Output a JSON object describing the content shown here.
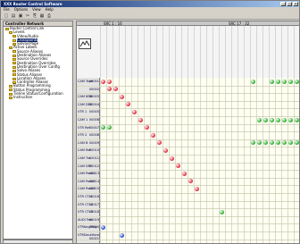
{
  "window": {
    "title": "XXX Router Control Software"
  },
  "menu": [
    "File",
    "Options",
    "View",
    "Help"
  ],
  "toolbar": {
    "icons": [
      "new-icon",
      "open-icon",
      "save-icon",
      "cut-icon",
      "copy-icon",
      "paste-icon",
      "print-icon"
    ]
  },
  "tree": {
    "title": "Controller Network",
    "items": [
      {
        "label": "Router Control Link",
        "indent": 0,
        "selected": false
      },
      {
        "label": "Levels",
        "indent": 1,
        "selected": false
      },
      {
        "label": "Video/Audio",
        "indent": 2,
        "selected": false
      },
      {
        "label": "Crosspoints",
        "indent": 2,
        "selected": true
      },
      {
        "label": "Salvos/Page",
        "indent": 2,
        "selected": false
      },
      {
        "label": "Active Labels",
        "indent": 1,
        "selected": false
      },
      {
        "label": "Source Aliases",
        "indent": 2,
        "selected": false
      },
      {
        "label": "Destination Aliases",
        "indent": 2,
        "selected": false
      },
      {
        "label": "Source Overrides",
        "indent": 2,
        "selected": false
      },
      {
        "label": "Destination Overrides",
        "indent": 2,
        "selected": false
      },
      {
        "label": "Destination Over Config",
        "indent": 2,
        "selected": false
      },
      {
        "label": "Salvo Aliases",
        "indent": 2,
        "selected": false
      },
      {
        "label": "Status Aliases",
        "indent": 2,
        "selected": false
      },
      {
        "label": "Location Aliases",
        "indent": 2,
        "selected": false
      },
      {
        "label": "Controller Aliases",
        "indent": 2,
        "selected": false
      },
      {
        "label": "Button Programming",
        "indent": 1,
        "selected": false
      },
      {
        "label": "Status Programming",
        "indent": 1,
        "selected": false
      },
      {
        "label": "Tieline Status/Configuration",
        "indent": 1,
        "selected": false
      },
      {
        "label": "Instruction",
        "indent": 1,
        "selected": false
      }
    ]
  },
  "grid": {
    "header_left": "SRC 1 : 16",
    "header_right": "SRC 17 : 32",
    "rows": [
      {
        "label": "CAM Tape",
        "num": "00001"
      },
      {
        "label": "",
        "num": "00002"
      },
      {
        "label": "CAM KEB",
        "num": "00003"
      },
      {
        "label": "CAM DEC",
        "num": "00004"
      },
      {
        "label": "VTR 1",
        "num": "00005"
      },
      {
        "label": "CAM 1",
        "num": "00006"
      },
      {
        "label": "VTR Ref",
        "num": "00007"
      },
      {
        "label": "VTR 2",
        "num": "00008"
      },
      {
        "label": "CAM B",
        "num": "00009"
      },
      {
        "label": "CAM Ref",
        "num": "00010"
      },
      {
        "label": "CAM Tra",
        "num": "00011"
      },
      {
        "label": "CAM DRF",
        "num": "00012"
      },
      {
        "label": "CAM Pack1",
        "num": "00013"
      },
      {
        "label": "CAM Pack2",
        "num": "00014"
      },
      {
        "label": "CAM Pack3",
        "num": "00015"
      },
      {
        "label": "VTR CTL1",
        "num": "00016"
      },
      {
        "label": "VTR CTL2",
        "num": "00017"
      },
      {
        "label": "VTR CTL3",
        "num": "00018"
      },
      {
        "label": "AUDI Test",
        "num": "00019"
      },
      {
        "label": "VTRKey/Play",
        "num": "00020"
      },
      {
        "label": "VTRDeckHere",
        "num": "00021"
      }
    ]
  },
  "colors": {
    "red": "#e03040",
    "green": "#30b030",
    "blue": "#3050d0",
    "accent": "#0a246a"
  }
}
